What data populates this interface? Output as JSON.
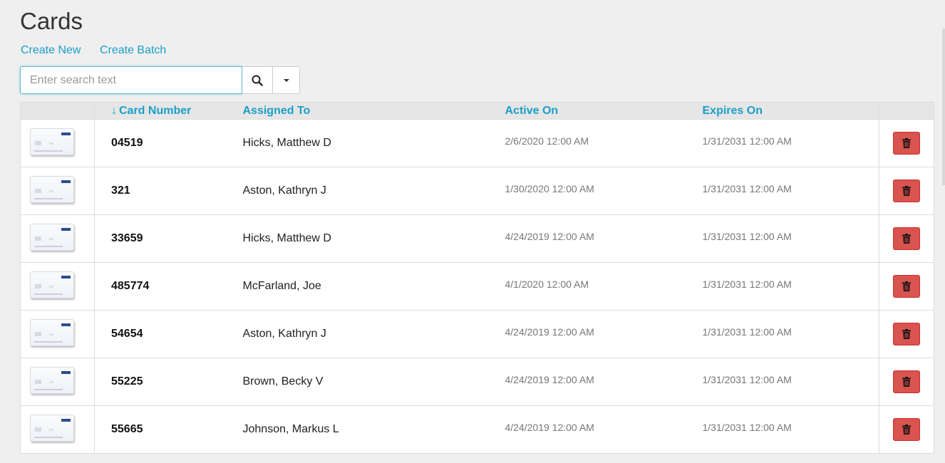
{
  "page": {
    "title": "Cards"
  },
  "actions": {
    "create_new": "Create New",
    "create_batch": "Create Batch"
  },
  "search": {
    "value": "",
    "placeholder": "Enter search text"
  },
  "icons": {
    "search": "search-icon",
    "dropdown": "caret-down-icon",
    "delete": "trash-icon",
    "sort": "sort-desc-arrow-icon"
  },
  "colors": {
    "link": "#1a9fc9",
    "delete": "#d9534f",
    "header_bg": "#e6e6e6"
  },
  "table": {
    "columns": {
      "card_number": "Card Number",
      "assigned_to": "Assigned To",
      "active_on": "Active On",
      "expires_on": "Expires On"
    },
    "sort_arrow": "↓",
    "rows": [
      {
        "card_number": "04519",
        "assigned_to": "Hicks, Matthew D",
        "active_on": "2/6/2020 12:00 AM",
        "expires_on": "1/31/2031 12:00 AM"
      },
      {
        "card_number": "321",
        "assigned_to": "Aston, Kathryn J",
        "active_on": "1/30/2020 12:00 AM",
        "expires_on": "1/31/2031 12:00 AM"
      },
      {
        "card_number": "33659",
        "assigned_to": "Hicks, Matthew D",
        "active_on": "4/24/2019 12:00 AM",
        "expires_on": "1/31/2031 12:00 AM"
      },
      {
        "card_number": "485774",
        "assigned_to": "McFarland, Joe",
        "active_on": "4/1/2020 12:00 AM",
        "expires_on": "1/31/2031 12:00 AM"
      },
      {
        "card_number": "54654",
        "assigned_to": "Aston, Kathryn J",
        "active_on": "4/24/2019 12:00 AM",
        "expires_on": "1/31/2031 12:00 AM"
      },
      {
        "card_number": "55225",
        "assigned_to": "Brown, Becky V",
        "active_on": "4/24/2019 12:00 AM",
        "expires_on": "1/31/2031 12:00 AM"
      },
      {
        "card_number": "55665",
        "assigned_to": "Johnson, Markus L",
        "active_on": "4/24/2019 12:00 AM",
        "expires_on": "1/31/2031 12:00 AM"
      }
    ]
  }
}
